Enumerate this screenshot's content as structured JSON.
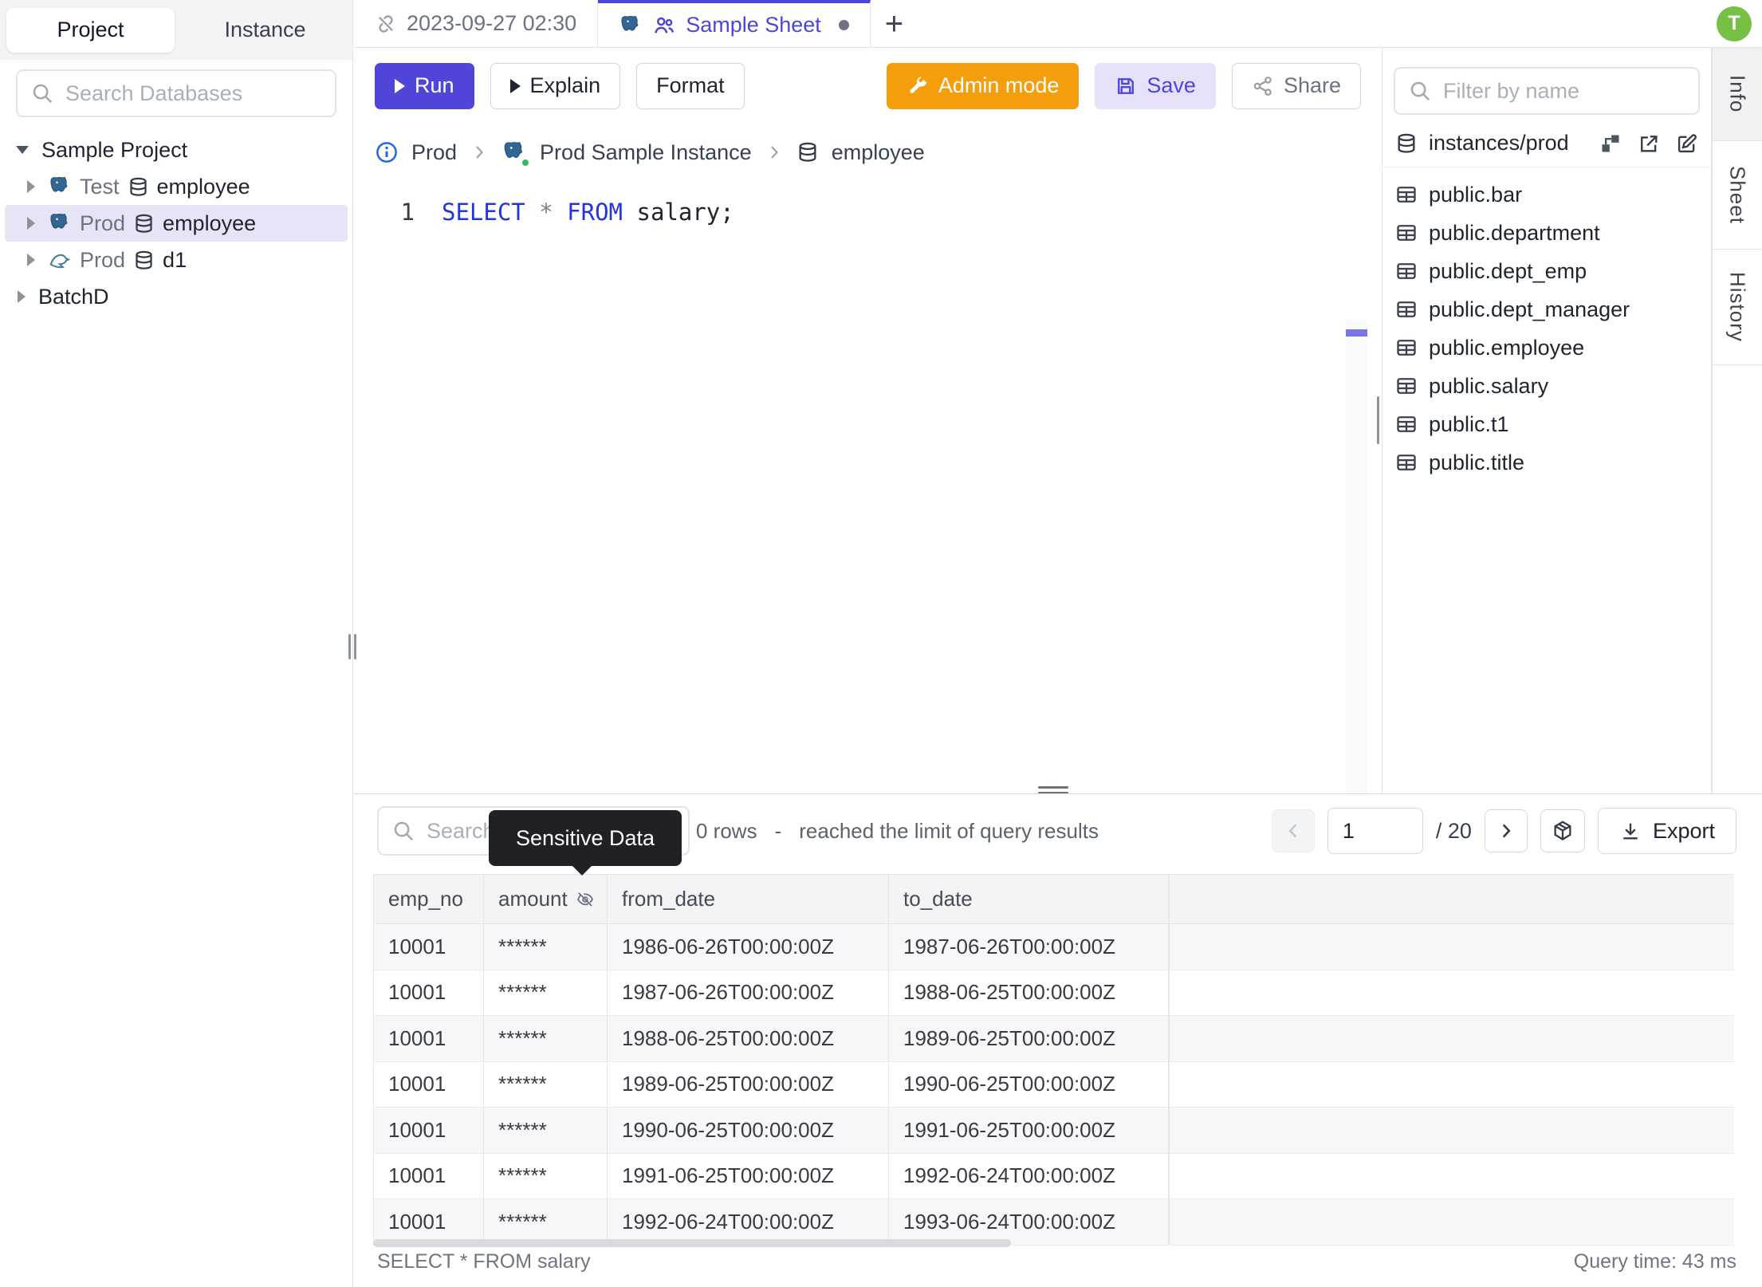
{
  "left_sidebar": {
    "tabs": [
      {
        "label": "Project"
      },
      {
        "label": "Instance"
      }
    ],
    "search_placeholder": "Search Databases",
    "tree": {
      "project": {
        "label": "Sample Project"
      },
      "db_test": {
        "env": "Test",
        "name": "employee"
      },
      "db_prod": {
        "env": "Prod",
        "name": "employee"
      },
      "db_prod2": {
        "env": "Prod",
        "name": "d1"
      },
      "batch": {
        "label": "BatchD"
      }
    }
  },
  "tabbar": {
    "history_tab": "2023-09-27 02:30",
    "active_tab": "Sample Sheet",
    "add": "+"
  },
  "avatar": {
    "initial": "T"
  },
  "toolbar": {
    "run": "Run",
    "explain": "Explain",
    "format": "Format",
    "admin": "Admin mode",
    "save": "Save",
    "share": "Share"
  },
  "breadcrumb": {
    "environment": "Prod",
    "instance": "Prod Sample Instance",
    "database": "employee"
  },
  "editor": {
    "line_number": "1",
    "sql": {
      "kw_select": "SELECT",
      "star": "*",
      "kw_from": "FROM",
      "rest": "salary;"
    }
  },
  "schema_panel": {
    "filter_placeholder": "Filter by name",
    "database_path": "instances/prod",
    "tables": [
      "public.bar",
      "public.department",
      "public.dept_emp",
      "public.dept_manager",
      "public.employee",
      "public.salary",
      "public.t1",
      "public.title"
    ],
    "side_tabs": [
      "Info",
      "Sheet",
      "History"
    ]
  },
  "results": {
    "search_placeholder": "Search",
    "tooltip": "Sensitive Data",
    "row_count": "0 rows",
    "dash": "-",
    "limit_note": "reached the limit of query results",
    "page": "1",
    "page_total": "/ 20",
    "export_label": "Export",
    "columns": [
      "emp_no",
      "amount",
      "from_date",
      "to_date"
    ],
    "rows": [
      [
        "10001",
        "******",
        "1986-06-26T00:00:00Z",
        "1987-06-26T00:00:00Z"
      ],
      [
        "10001",
        "******",
        "1987-06-26T00:00:00Z",
        "1988-06-25T00:00:00Z"
      ],
      [
        "10001",
        "******",
        "1988-06-25T00:00:00Z",
        "1989-06-25T00:00:00Z"
      ],
      [
        "10001",
        "******",
        "1989-06-25T00:00:00Z",
        "1990-06-25T00:00:00Z"
      ],
      [
        "10001",
        "******",
        "1990-06-25T00:00:00Z",
        "1991-06-25T00:00:00Z"
      ],
      [
        "10001",
        "******",
        "1991-06-25T00:00:00Z",
        "1992-06-24T00:00:00Z"
      ],
      [
        "10001",
        "******",
        "1992-06-24T00:00:00Z",
        "1993-06-24T00:00:00Z"
      ]
    ]
  },
  "status_bar": {
    "query": "SELECT * FROM salary",
    "time": "Query time: 43 ms"
  },
  "colors": {
    "accent": "#4f45d9",
    "admin_orange": "#f59e0b",
    "avatar_green": "#76c043",
    "tooltip_bg": "#202127",
    "keyword_blue": "#2336dd",
    "status_green": "#2ebd59"
  }
}
